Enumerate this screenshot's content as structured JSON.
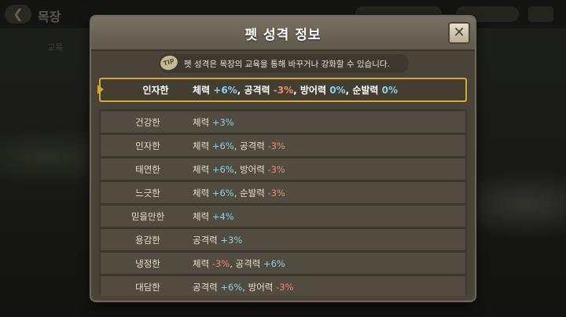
{
  "background": {
    "title": "목장",
    "subtitle": "교육"
  },
  "dialog": {
    "title": "펫 성격 정보",
    "close_icon": "close-icon",
    "tip": {
      "badge": "TIP",
      "text": "펫 성격은 목장의 교육을 통해 바꾸거나  강화할 수 있습니다."
    },
    "current": {
      "name": "인자한",
      "effects": [
        {
          "stat": "체력",
          "value": "+6%",
          "tone": "pos",
          "sep": ", "
        },
        {
          "stat": "공격력",
          "value": "-3%",
          "tone": "neg",
          "sep": ", "
        },
        {
          "stat": "방어력",
          "value": "0%",
          "tone": "pos",
          "sep": ", "
        },
        {
          "stat": "순발력",
          "value": "0%",
          "tone": "pos",
          "sep": ""
        }
      ]
    },
    "personalities": [
      {
        "name": "건강한",
        "effects": [
          {
            "stat": "체력",
            "value": "+3%",
            "tone": "pos",
            "sep": ""
          }
        ]
      },
      {
        "name": "인자한",
        "effects": [
          {
            "stat": "체력",
            "value": "+6%",
            "tone": "pos",
            "sep": ", "
          },
          {
            "stat": "공격력",
            "value": "-3%",
            "tone": "neg",
            "sep": ""
          }
        ]
      },
      {
        "name": "태연한",
        "effects": [
          {
            "stat": "체력",
            "value": "+6%",
            "tone": "pos",
            "sep": ", "
          },
          {
            "stat": "방어력",
            "value": "-3%",
            "tone": "neg",
            "sep": ""
          }
        ]
      },
      {
        "name": "느긋한",
        "effects": [
          {
            "stat": "체력",
            "value": "+6%",
            "tone": "pos",
            "sep": ", "
          },
          {
            "stat": "순발력",
            "value": "-3%",
            "tone": "neg",
            "sep": ""
          }
        ]
      },
      {
        "name": "믿을만한",
        "effects": [
          {
            "stat": "체력",
            "value": "+4%",
            "tone": "pos",
            "sep": ""
          }
        ]
      },
      {
        "name": "용감한",
        "effects": [
          {
            "stat": "공격력",
            "value": "+3%",
            "tone": "pos",
            "sep": ""
          }
        ]
      },
      {
        "name": "냉정한",
        "effects": [
          {
            "stat": "체력",
            "value": "-3%",
            "tone": "neg",
            "sep": ", "
          },
          {
            "stat": "공격력",
            "value": "+6%",
            "tone": "pos",
            "sep": ""
          }
        ]
      },
      {
        "name": "대담한",
        "effects": [
          {
            "stat": "공격력",
            "value": "+6%",
            "tone": "pos",
            "sep": ", "
          },
          {
            "stat": "방어력",
            "value": "-3%",
            "tone": "neg",
            "sep": ""
          }
        ]
      }
    ]
  },
  "colors": {
    "positive": "#8fd0e8",
    "negative": "#f08a72",
    "highlight_border": "#d4a93a"
  }
}
